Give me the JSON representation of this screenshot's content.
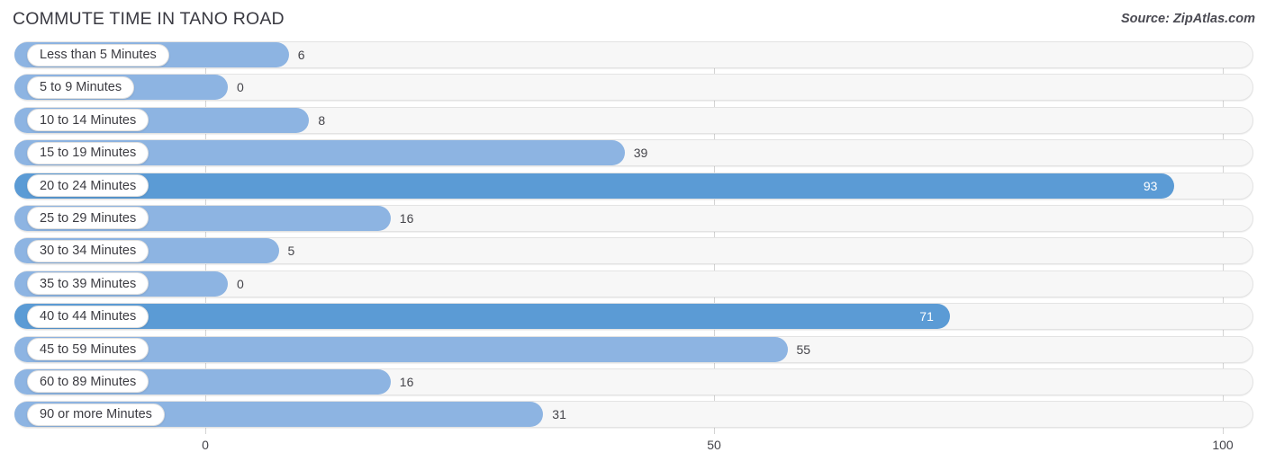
{
  "header": {
    "title": "COMMUTE TIME IN TANO ROAD",
    "source": "Source: ZipAtlas.com"
  },
  "colors": {
    "bar_light": "#8db4e2",
    "bar_dark": "#5b9bd5",
    "track": "#f7f7f7",
    "gridline": "#d4d4d4",
    "label_text": "#3c3c42",
    "value_text": "#44444a",
    "value_text_inside": "#ffffff"
  },
  "chart_data": {
    "type": "bar",
    "orientation": "horizontal",
    "title": "COMMUTE TIME IN TANO ROAD",
    "xlabel": "",
    "ylabel": "",
    "xlim": [
      0,
      100
    ],
    "xticks": [
      0,
      50,
      100
    ],
    "xtick_labels": [
      "0",
      "50",
      "100"
    ],
    "grid": true,
    "legend": false,
    "categories": [
      "Less than 5 Minutes",
      "5 to 9 Minutes",
      "10 to 14 Minutes",
      "15 to 19 Minutes",
      "20 to 24 Minutes",
      "25 to 29 Minutes",
      "30 to 34 Minutes",
      "35 to 39 Minutes",
      "40 to 44 Minutes",
      "45 to 59 Minutes",
      "60 to 89 Minutes",
      "90 or more Minutes"
    ],
    "values": [
      6,
      0,
      8,
      39,
      93,
      16,
      5,
      0,
      71,
      55,
      16,
      31
    ],
    "value_labels": [
      "6",
      "0",
      "8",
      "39",
      "93",
      "16",
      "5",
      "0",
      "71",
      "55",
      "16",
      "31"
    ],
    "highlighted": [
      false,
      false,
      false,
      false,
      true,
      false,
      false,
      false,
      true,
      false,
      false,
      false
    ]
  }
}
